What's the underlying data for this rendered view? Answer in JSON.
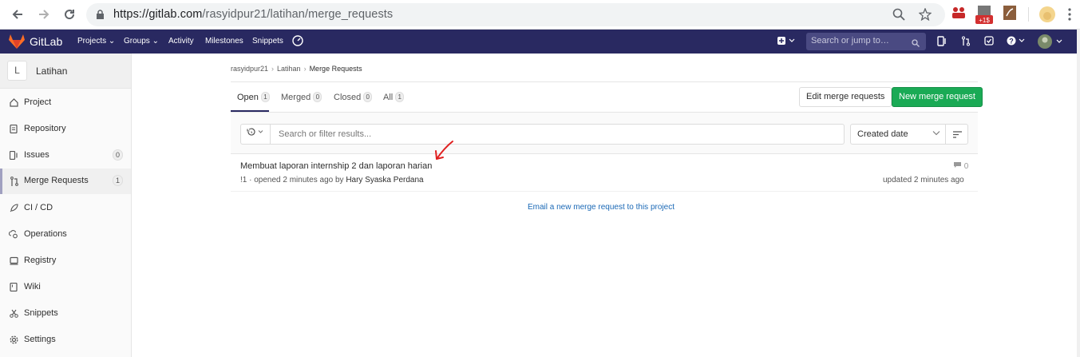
{
  "browser": {
    "url_host": "https://gitlab.com",
    "url_path": "/rasyidpur21/latihan/merge_requests",
    "ext_badge": "+1$"
  },
  "navbar": {
    "brand": "GitLab",
    "menu": [
      "Projects",
      "Groups",
      "Activity",
      "Milestones",
      "Snippets"
    ],
    "search_placeholder": "Search or jump to…"
  },
  "sidebar": {
    "avatar_letter": "L",
    "project_name": "Latihan",
    "items": [
      {
        "label": "Project",
        "icon": "home-icon"
      },
      {
        "label": "Repository",
        "icon": "doc-icon"
      },
      {
        "label": "Issues",
        "icon": "issues-icon",
        "badge": "0"
      },
      {
        "label": "Merge Requests",
        "icon": "merge-request-icon",
        "badge": "1"
      },
      {
        "label": "CI / CD",
        "icon": "rocket-icon"
      },
      {
        "label": "Operations",
        "icon": "cloud-gear-icon"
      },
      {
        "label": "Registry",
        "icon": "registry-icon"
      },
      {
        "label": "Wiki",
        "icon": "book-icon"
      },
      {
        "label": "Snippets",
        "icon": "scissors-icon"
      },
      {
        "label": "Settings",
        "icon": "settings-icon"
      }
    ]
  },
  "breadcrumb": {
    "user": "rasyidpur21",
    "project": "Latihan",
    "page": "Merge Requests"
  },
  "tabs": [
    {
      "label": "Open",
      "count": "1"
    },
    {
      "label": "Merged",
      "count": "0"
    },
    {
      "label": "Closed",
      "count": "0"
    },
    {
      "label": "All",
      "count": "1"
    }
  ],
  "buttons": {
    "edit": "Edit merge requests",
    "new": "New merge request"
  },
  "filter": {
    "placeholder": "Search or filter results...",
    "sort_label": "Created date"
  },
  "merge_request": {
    "title": "Membuat laporan internship 2 dan laporan harian",
    "meta_prefix": "!1 · opened 2 minutes ago by ",
    "author": "Hary Syaska Perdana",
    "comments": "0",
    "updated": "updated 2 minutes ago"
  },
  "email_link": "Email a new merge request to this project",
  "colors": {
    "navbar": "#292961",
    "success": "#1aaa55",
    "link": "#1b69b6"
  }
}
